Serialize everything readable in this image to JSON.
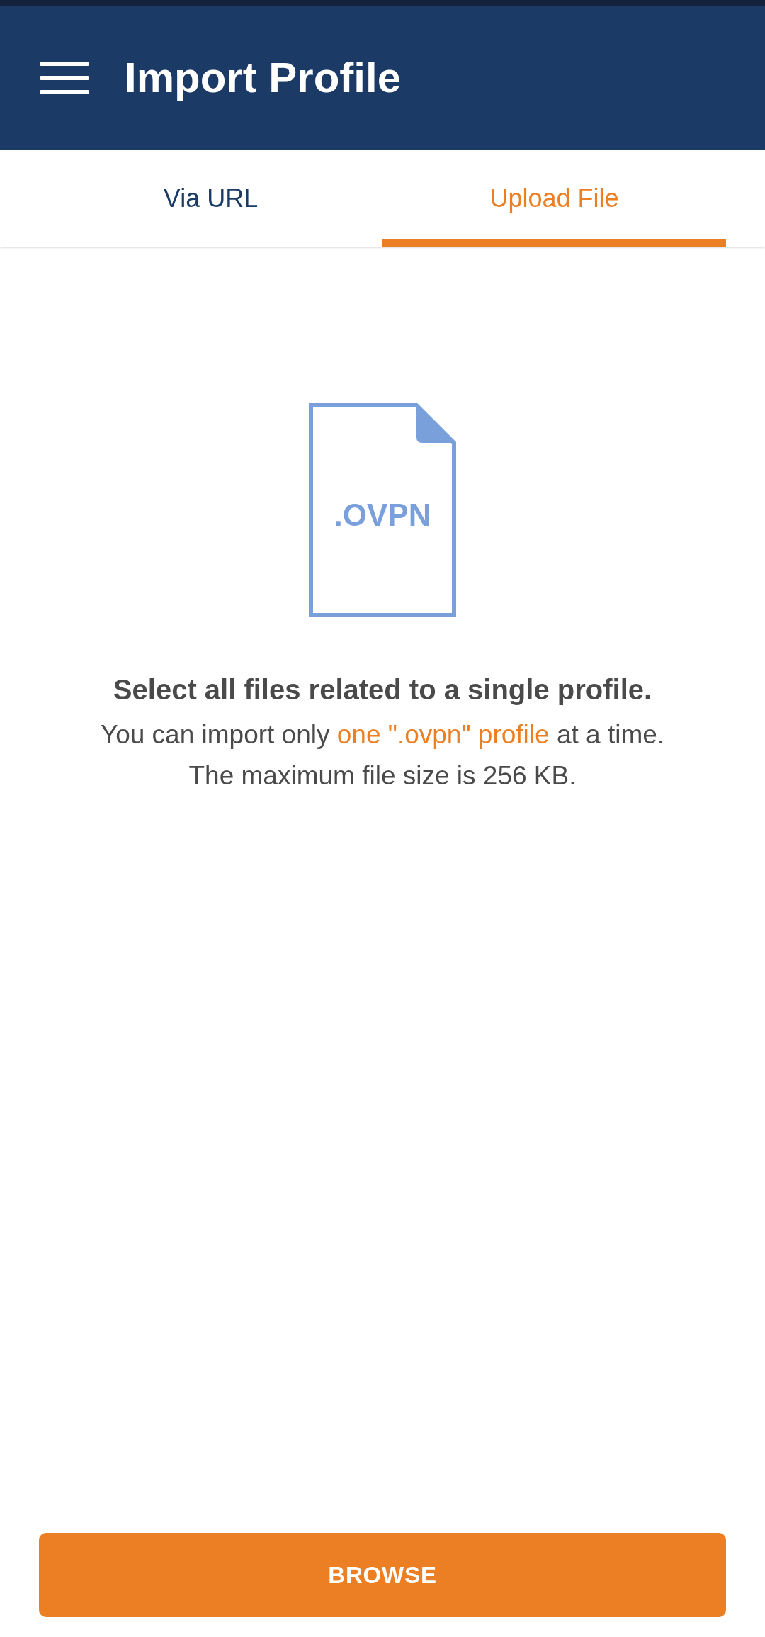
{
  "header": {
    "title": "Import Profile"
  },
  "tabs": [
    {
      "label": "Via URL",
      "selected": false
    },
    {
      "label": "Upload File",
      "selected": true
    }
  ],
  "file_icon": {
    "label": ".OVPN"
  },
  "heading": "Select all files related to a single profile.",
  "description": {
    "before": "You can import only ",
    "link": "one \".ovpn\" profile",
    "after": " at a time."
  },
  "note": "The maximum file size is 256 KB.",
  "button": {
    "label": "BROWSE"
  }
}
